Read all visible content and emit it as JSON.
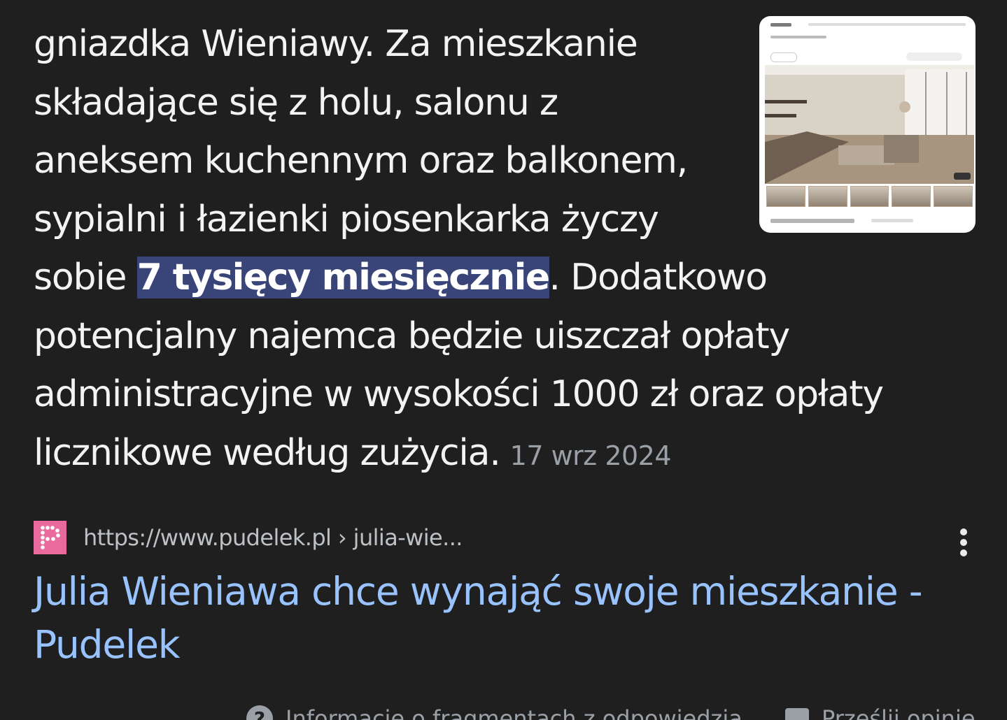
{
  "snippet": {
    "line1": "gniazdka Wieniawy. Za mieszkanie",
    "line2": "składające się z holu, salonu z",
    "line3": "aneksem kuchennym oraz balkonem,",
    "line4": "sypialni i łazienki piosenkarka życzy",
    "line5_before": "sobie ",
    "line5_highlight": "7 tysięcy miesięcznie",
    "line5_after": ". Dodatkowo",
    "line6": "potencjalny najemca będzie uiszczał opłaty",
    "line7": "administracyjne w wysokości 1000 zł oraz opłaty",
    "line8": "licznikowe według zużycia.",
    "date": "17 wrz 2024"
  },
  "thumbnail": {
    "icon": "apartment-listing-screenshot"
  },
  "result": {
    "favicon_letter": "P",
    "url": "https://www.pudelek.pl › julia-wie...",
    "title_line1": "Julia Wieniawa chce wynająć swoje mieszkanie -",
    "title_line2": "Pudelek"
  },
  "footer": {
    "snippet_info": "Informacje o fragmentach z odpowiedzią",
    "feedback": "Prześlij opinię"
  },
  "colors": {
    "background": "#1f1f1f",
    "highlight": "#394579",
    "link": "#99c3ff",
    "favicon": "#e96b9d"
  }
}
